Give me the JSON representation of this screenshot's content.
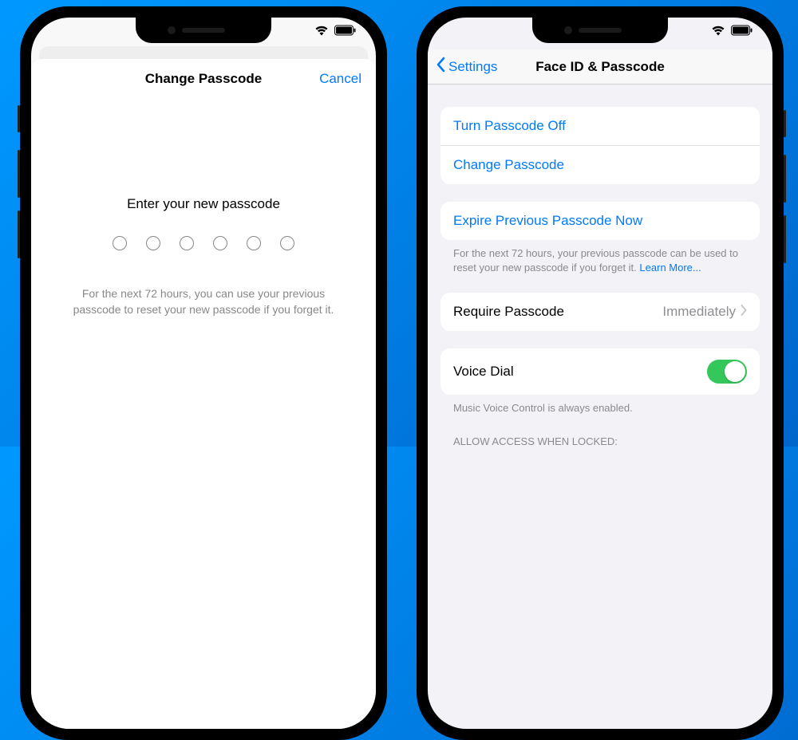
{
  "left_phone": {
    "status": {
      "wifi": true,
      "battery_full": true
    },
    "sheet": {
      "title": "Change Passcode",
      "cancel": "Cancel",
      "prompt": "Enter your new passcode",
      "passcode_length": 6,
      "help": "For the next 72 hours, you can use your previous passcode to reset your new passcode if you forget it."
    }
  },
  "right_phone": {
    "status": {
      "wifi": true,
      "battery_full": true
    },
    "nav": {
      "back": "Settings",
      "title": "Face ID & Passcode"
    },
    "groups": {
      "passcode": {
        "turn_off": "Turn Passcode Off",
        "change": "Change Passcode"
      },
      "expire": {
        "label": "Expire Previous Passcode Now",
        "footer": "For the next 72 hours, your previous passcode can be used to reset your new passcode if you forget it.",
        "learn_more": "Learn More..."
      },
      "require": {
        "label": "Require Passcode",
        "value": "Immediately"
      },
      "voice_dial": {
        "label": "Voice Dial",
        "enabled": true,
        "footer": "Music Voice Control is always enabled."
      },
      "allow_header": "ALLOW ACCESS WHEN LOCKED:"
    }
  }
}
